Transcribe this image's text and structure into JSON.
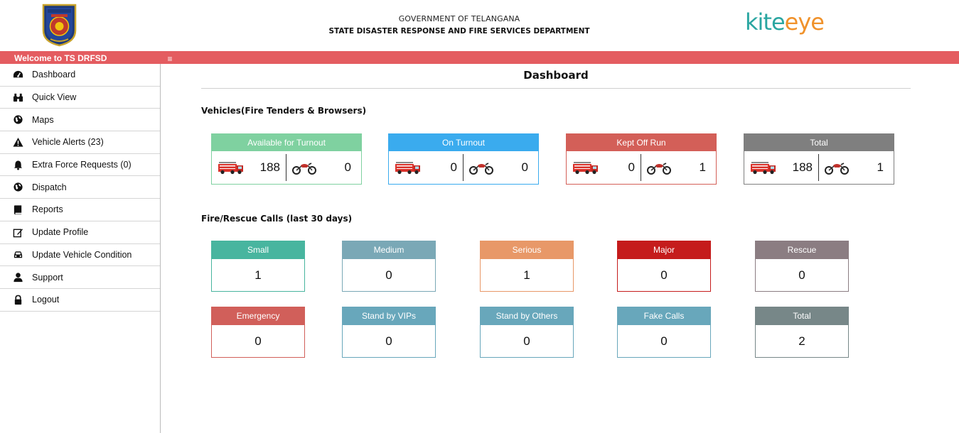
{
  "header": {
    "gov_line1": "GOVERNMENT OF TELANGANA",
    "gov_line2": "STATE DISASTER RESPONSE AND FIRE SERVICES DEPARTMENT",
    "logo_text_top": "TELANGANA STATE",
    "logo_text_mid": "FIRE",
    "brand_part1": "kite",
    "brand_part2": "eye"
  },
  "topbar": {
    "welcome": "Welcome to TS DRFSD",
    "menu_icon": "≡"
  },
  "sidebar": {
    "items": [
      {
        "label": "Dashboard",
        "icon": "dashboard-icon"
      },
      {
        "label": "Quick View",
        "icon": "binoculars-icon"
      },
      {
        "label": "Maps",
        "icon": "globe-icon"
      },
      {
        "label": "Vehicle Alerts (23)",
        "icon": "warning-icon"
      },
      {
        "label": "Extra Force Requests (0)",
        "icon": "bell-icon"
      },
      {
        "label": "Dispatch",
        "icon": "globe-icon"
      },
      {
        "label": "Reports",
        "icon": "book-icon"
      },
      {
        "label": "Update Profile",
        "icon": "edit-icon"
      },
      {
        "label": "Update Vehicle Condition",
        "icon": "car-icon"
      },
      {
        "label": "Support",
        "icon": "user-icon"
      },
      {
        "label": "Logout",
        "icon": "lock-icon"
      }
    ]
  },
  "main": {
    "title": "Dashboard",
    "vehicles_heading": "Vehicles(Fire Tenders & Browsers)",
    "calls_heading": "Fire/Rescue Calls (last 30 days)"
  },
  "vehicles": [
    {
      "label": "Available for Turnout",
      "tenders": "188",
      "bikes": "0",
      "color": "#7fd1a0"
    },
    {
      "label": "On Turnout",
      "tenders": "0",
      "bikes": "0",
      "color": "#3aabee"
    },
    {
      "label": "Kept Off Run",
      "tenders": "0",
      "bikes": "1",
      "color": "#d35f58"
    },
    {
      "label": "Total",
      "tenders": "188",
      "bikes": "1",
      "color": "#7f7f7f"
    }
  ],
  "calls": [
    {
      "label": "Small",
      "value": "1",
      "color": "#48b59f"
    },
    {
      "label": "Medium",
      "value": "0",
      "color": "#7aa8b6"
    },
    {
      "label": "Serious",
      "value": "1",
      "color": "#e89868"
    },
    {
      "label": "Major",
      "value": "0",
      "color": "#c51c1c"
    },
    {
      "label": "Rescue",
      "value": "0",
      "color": "#8b7d82"
    },
    {
      "label": "Emergency",
      "value": "0",
      "color": "#d15f5a"
    },
    {
      "label": "Stand by VIPs",
      "value": "0",
      "color": "#68a7bb"
    },
    {
      "label": "Stand by Others",
      "value": "0",
      "color": "#68a7bb"
    },
    {
      "label": "Fake Calls",
      "value": "0",
      "color": "#68a7bb"
    },
    {
      "label": "Total",
      "value": "2",
      "color": "#778788"
    }
  ]
}
